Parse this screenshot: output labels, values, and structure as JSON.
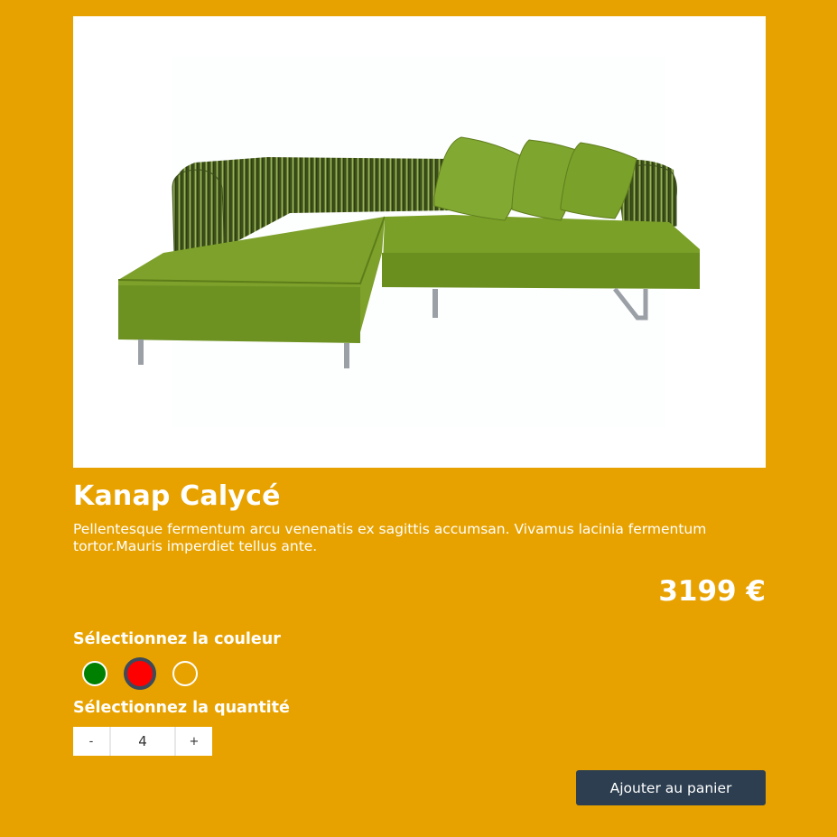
{
  "product": {
    "title": "Kanap Calycé",
    "description": "Pellentesque fermentum arcu venenatis ex sagittis accumsan. Vivamus lacinia fermentum tortor.Mauris imperdiet tellus ante.",
    "price": "3199 €",
    "image_subject": "green-sectional-sofa"
  },
  "colors": {
    "label": "Sélectionnez la couleur",
    "options": [
      {
        "name": "green",
        "hex": "#008000",
        "selected": false
      },
      {
        "name": "red",
        "hex": "#ff0000",
        "selected": true
      },
      {
        "name": "orange",
        "hex": "#e8a200",
        "selected": false
      }
    ]
  },
  "quantity": {
    "label": "Sélectionnez la quantité",
    "decrement": "-",
    "increment": "+",
    "value": "4"
  },
  "cart": {
    "button_label": "Ajouter au panier"
  },
  "theme": {
    "background": "#e8a200",
    "button": "#2c3e50",
    "swatch_selected_border": "#3d4a5a"
  }
}
